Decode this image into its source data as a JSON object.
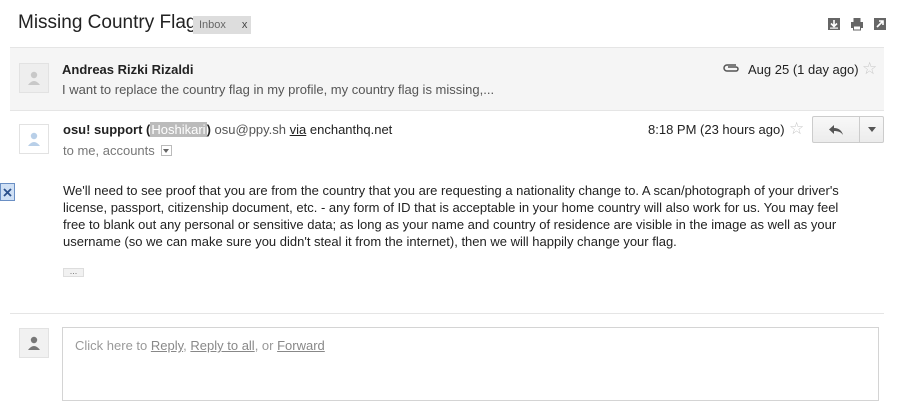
{
  "thread": {
    "subject": "Missing Country Flag",
    "label": "Inbox",
    "label_remove": "x"
  },
  "toolbar_icons": [
    "download-icon",
    "print-icon",
    "new-window-icon"
  ],
  "collapsed_message": {
    "sender": "Andreas Rizki Rizaldi",
    "snippet": "I want to replace the country flag in my profile, my country flag is missing,...",
    "date": "Aug 25 (1 day ago)",
    "has_attachment": true
  },
  "message": {
    "sender_name": "osu! support",
    "open_paren": " (",
    "alias": "Hoshikari",
    "close_paren": ")",
    "email": " osu@ppy.sh ",
    "via": "via",
    "via_domain": " enchanthq.net",
    "time": "8:18 PM (23 hours ago)",
    "to": "to me, accounts",
    "body": "We'll need to see proof that you are from the country that you are requesting a nationality change to. A scan/photograph of your driver's license, passport, citizenship document, etc. - any form of ID that is acceptable in your home country will also work for us. You may feel free to blank out any personal or sensitive data; as long as your name and country of residence are visible in the image as well as your username (so we can make sure you didn't steal it from the internet), then we will happily change your flag.",
    "ellipsis": "..."
  },
  "reply_box": {
    "prefix": "Click here to ",
    "reply": "Reply",
    "sep1": ", ",
    "reply_all": "Reply to all",
    "sep2": ", or ",
    "forward": "Forward"
  },
  "colors": {
    "star": "#c8c8c8",
    "label_bg": "#dddddd",
    "highlight": "#bbbbbb"
  }
}
